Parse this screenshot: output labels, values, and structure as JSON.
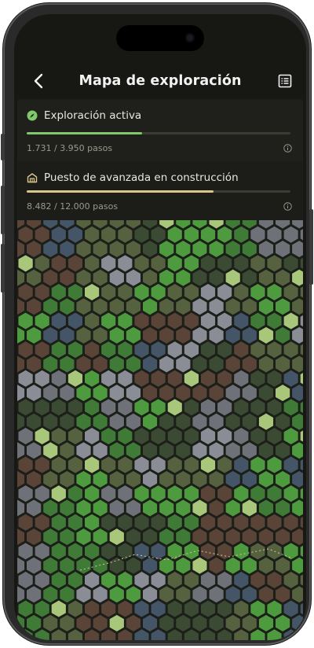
{
  "header": {
    "title": "Mapa de exploración",
    "back_icon": "chevron-left-icon",
    "list_icon": "list-icon"
  },
  "progress": [
    {
      "icon": "compass-icon",
      "label": "Exploración activa",
      "steps": "1.731 / 3.950 pasos",
      "fraction": 0.438,
      "color": "#7fc96a"
    },
    {
      "icon": "building-icon",
      "label": "Puesto de avanzada en construcción",
      "steps": "8.482 / 12.000 pasos",
      "fraction": 0.707,
      "color": "#d8c58a"
    }
  ],
  "map": {
    "palette": {
      "dark_green": "#3b4a32",
      "olive": "#55613f",
      "green": "#3f7a37",
      "bright_green": "#4d9a3f",
      "light_green": "#a8c77a",
      "brown": "#5a4438",
      "gray": "#6e7177",
      "light_gray": "#8a8d96",
      "blue_gray": "#435566",
      "blue": "#3f84b8",
      "rust": "#a0553f"
    }
  }
}
